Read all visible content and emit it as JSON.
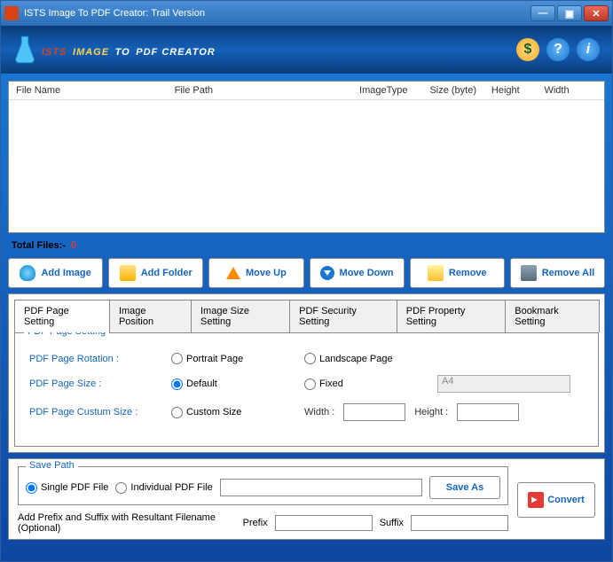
{
  "window": {
    "title": "ISTS Image To PDF Creator: Trail Version"
  },
  "brand": {
    "ists": "ISTS",
    "image": "IMAGE",
    "to": "TO",
    "rest": "PDF CREATOR"
  },
  "header_icons": {
    "dollar": "$",
    "help": "?",
    "info": "i"
  },
  "filelist": {
    "cols": {
      "name": "File Name",
      "path": "File Path",
      "type": "ImageType",
      "size": "Size (byte)",
      "height": "Height",
      "width": "Width"
    }
  },
  "totals": {
    "label": "Total Files:-",
    "count": "0"
  },
  "buttons": {
    "add_image": "Add Image",
    "add_folder": "Add Folder",
    "move_up": "Move Up",
    "move_down": "Move Down",
    "remove": "Remove",
    "remove_all": "Remove All"
  },
  "tabs": {
    "page": "PDF Page Setting",
    "pos": "Image Position",
    "size": "Image Size Setting",
    "sec": "PDF Security Setting",
    "prop": "PDF Property Setting",
    "bm": "Bookmark Setting"
  },
  "page_setting": {
    "legend": "PDF Page Setting",
    "rotation_label": "PDF Page Rotation :",
    "portrait": "Portrait Page",
    "landscape": "Landscape Page",
    "size_label": "PDF Page Size :",
    "default": "Default",
    "fixed": "Fixed",
    "fixed_value": "A4",
    "custom_label": "PDF Page Custum Size :",
    "custom": "Custom Size",
    "width": "Width :",
    "height": "Height :"
  },
  "save": {
    "legend": "Save Path",
    "single": "Single PDF File",
    "individual": "Individual PDF File",
    "saveas": "Save As",
    "suffix_label": "Add Prefix and Suffix with Resultant Filename (Optional)",
    "prefix": "Prefix",
    "suffix": "Suffix"
  },
  "convert": "Convert"
}
